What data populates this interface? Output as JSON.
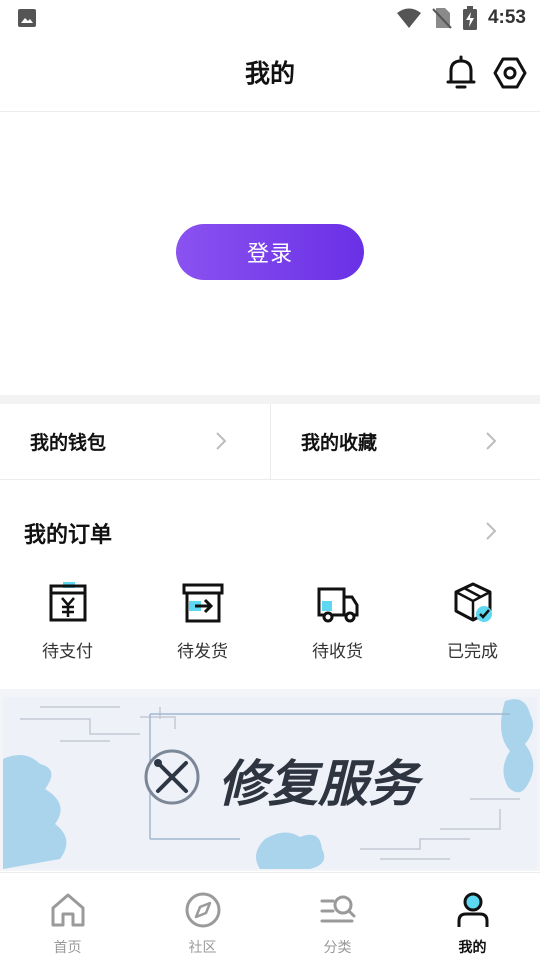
{
  "status_bar": {
    "time": "4:53"
  },
  "header": {
    "title": "我的"
  },
  "login": {
    "button_label": "登录"
  },
  "quick_links": [
    {
      "label": "我的钱包"
    },
    {
      "label": "我的收藏"
    }
  ],
  "orders": {
    "title": "我的订单",
    "items": [
      {
        "label": "待支付",
        "icon": "pending-payment-icon"
      },
      {
        "label": "待发货",
        "icon": "to-ship-icon"
      },
      {
        "label": "待收货",
        "icon": "truck-icon"
      },
      {
        "label": "已完成",
        "icon": "completed-box-icon"
      }
    ]
  },
  "banner": {
    "text": "修复服务"
  },
  "bottom_nav": [
    {
      "label": "首页",
      "icon": "home-icon",
      "active": false
    },
    {
      "label": "社区",
      "icon": "compass-icon",
      "active": false
    },
    {
      "label": "分类",
      "icon": "category-search-icon",
      "active": false
    },
    {
      "label": "我的",
      "icon": "profile-icon",
      "active": true
    }
  ],
  "colors": {
    "accent_start": "#8a52f0",
    "accent_end": "#6a30e6",
    "icon_cyan": "#5ed8f0",
    "banner_blue": "#a9d4ec"
  }
}
